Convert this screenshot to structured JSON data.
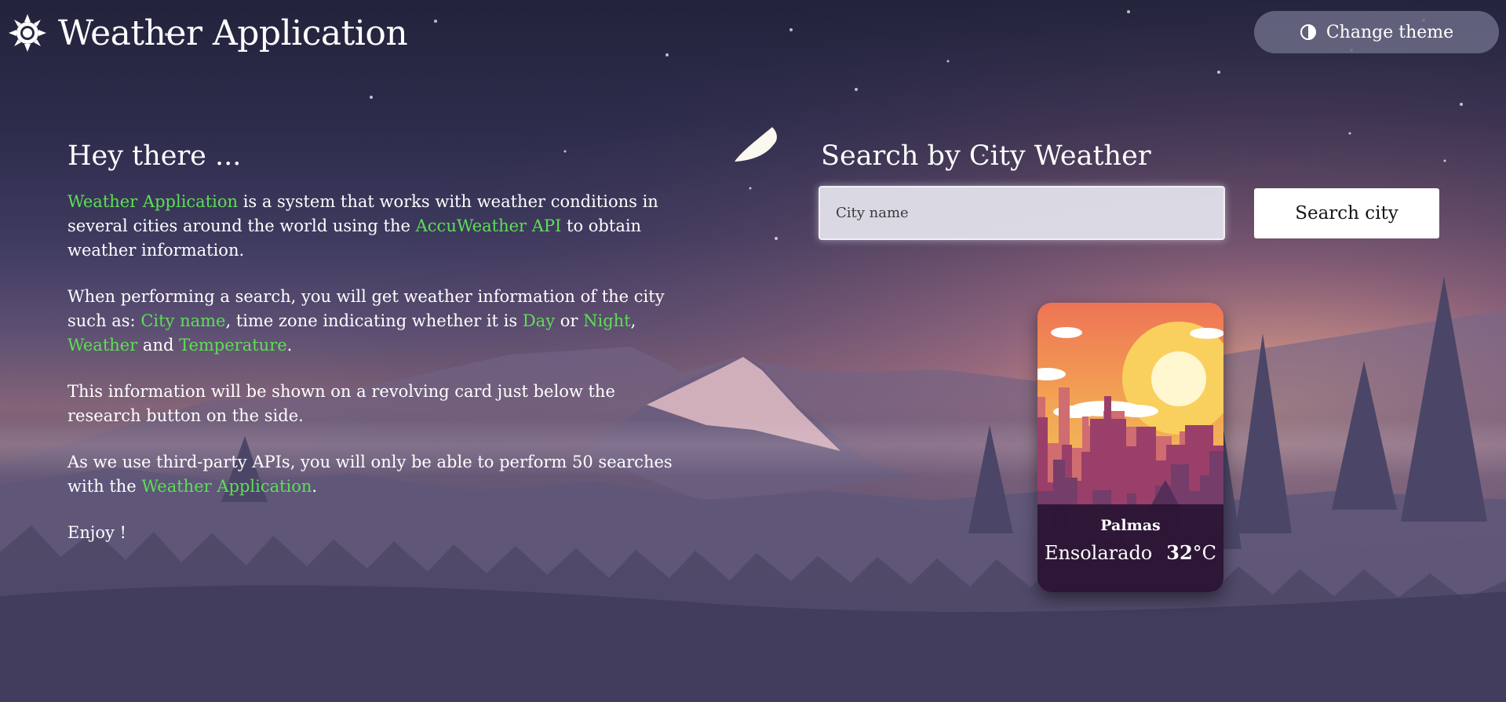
{
  "app": {
    "title": "Weather Application",
    "theme_button_label": "Change theme"
  },
  "intro": {
    "heading": "Hey there ...",
    "paragraph1": {
      "highlight1": "Weather Application",
      "text1": " is a system that works with weather conditions in several cities around the world using the ",
      "highlight2": "AccuWeather API",
      "text2": " to obtain weather information."
    },
    "paragraph2": {
      "text1": "When performing a search, you will get weather information of the city such as: ",
      "highlight1": "City name",
      "text2": ", time zone indicating whether it is ",
      "highlight2": "Day",
      "text3": " or ",
      "highlight3": "Night",
      "text4": ", ",
      "highlight4": "Weather",
      "text5": " and ",
      "highlight5": "Temperature",
      "text6": "."
    },
    "paragraph3": "This information will be shown on a revolving card just below the research button on the side.",
    "paragraph4": {
      "text1": "As we use third-party APIs, you will only be able to perform 50 searches with the ",
      "highlight1": "Weather Application",
      "text2": "."
    },
    "paragraph5": "Enjoy !"
  },
  "search": {
    "heading": "Search by City Weather",
    "input_placeholder": "City name",
    "input_value": "",
    "button_label": "Search city"
  },
  "card": {
    "city": "Palmas",
    "condition": "Ensolarado",
    "temperature": "32",
    "unit": "°C"
  },
  "colors": {
    "highlight": "#5ddf55",
    "night_sky": "#22233b",
    "card_info_background": "#2a1534"
  },
  "icons": {
    "app_logo": "sun-icon",
    "theme_toggle": "contrast-icon"
  }
}
